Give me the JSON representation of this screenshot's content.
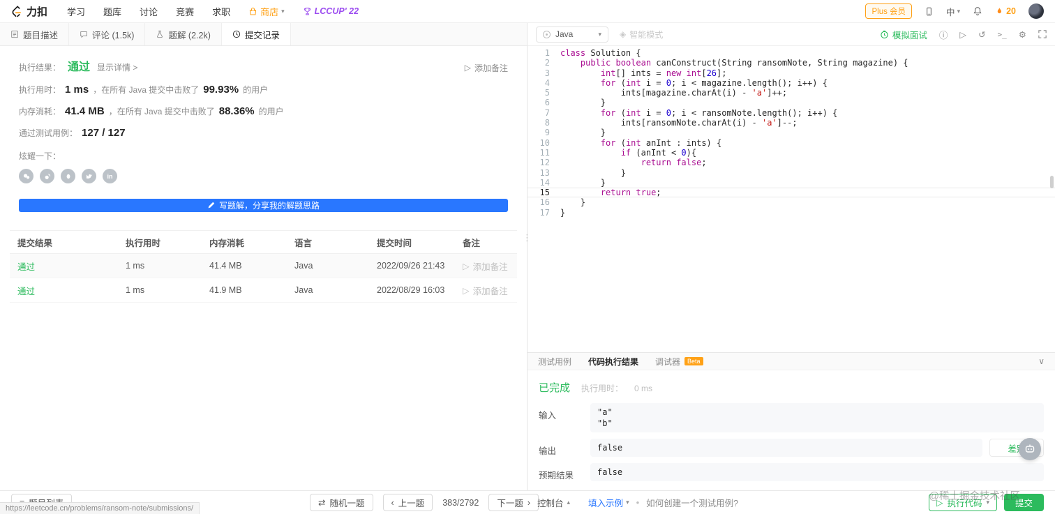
{
  "navbar": {
    "logo_text": "力扣",
    "menu": [
      "学习",
      "题库",
      "讨论",
      "竞赛",
      "求职"
    ],
    "store_label": "商店",
    "lccup_label": "LCCUP' 22",
    "plus_label": "Plus 会员",
    "lang_label": "中",
    "streak_count": "20"
  },
  "left_tabs": {
    "description": "题目描述",
    "comments": "评论 (1.5k)",
    "solutions": "题解 (2.2k)",
    "submissions": "提交记录"
  },
  "result": {
    "exec_label": "执行结果：",
    "status": "通过",
    "detail_link": "显示详情 >",
    "add_note": "添加备注",
    "runtime_label": "执行用时：",
    "runtime_value": "1 ms",
    "runtime_mid": "，在所有 Java 提交中击败了",
    "runtime_pct": "99.93%",
    "runtime_suffix": "的用户",
    "memory_label": "内存消耗：",
    "memory_value": "41.4 MB",
    "memory_mid": "，在所有 Java 提交中击败了",
    "memory_pct": "88.36%",
    "memory_suffix": "的用户",
    "cases_label": "通过测试用例：",
    "cases_value": "127 / 127",
    "brag_label": "炫耀一下：",
    "write_solution": "写题解，分享我的解题思路"
  },
  "table": {
    "headers": [
      "提交结果",
      "执行用时",
      "内存消耗",
      "语言",
      "提交时间",
      "备注"
    ],
    "rows": [
      {
        "status": "通过",
        "runtime": "1 ms",
        "memory": "41.4 MB",
        "lang": "Java",
        "time": "2022/09/26 21:43",
        "note": "添加备注"
      },
      {
        "status": "通过",
        "runtime": "1 ms",
        "memory": "41.9 MB",
        "lang": "Java",
        "time": "2022/08/29 16:03",
        "note": "添加备注"
      }
    ]
  },
  "editor": {
    "language": "Java",
    "smart_mode": "智能模式",
    "mock_interview": "模拟面试",
    "lines": [
      {
        "n": "1",
        "t": [
          [
            "k",
            "class"
          ],
          [
            "p",
            " Solution {"
          ]
        ]
      },
      {
        "n": "2",
        "t": [
          [
            "p",
            "    "
          ],
          [
            "k",
            "public"
          ],
          [
            "p",
            " "
          ],
          [
            "k",
            "boolean"
          ],
          [
            "p",
            " canConstruct(String ransomNote, String magazine) {"
          ]
        ]
      },
      {
        "n": "3",
        "t": [
          [
            "p",
            "        "
          ],
          [
            "k",
            "int"
          ],
          [
            "p",
            "[] ints = "
          ],
          [
            "k",
            "new"
          ],
          [
            "p",
            " "
          ],
          [
            "k",
            "int"
          ],
          [
            "p",
            "["
          ],
          [
            "n2",
            "26"
          ],
          [
            "p",
            "];"
          ]
        ]
      },
      {
        "n": "4",
        "t": [
          [
            "p",
            "        "
          ],
          [
            "k",
            "for"
          ],
          [
            "p",
            " ("
          ],
          [
            "k",
            "int"
          ],
          [
            "p",
            " i = "
          ],
          [
            "n2",
            "0"
          ],
          [
            "p",
            "; i < magazine.length(); i++) {"
          ]
        ]
      },
      {
        "n": "5",
        "t": [
          [
            "p",
            "            ints[magazine.charAt(i) - "
          ],
          [
            "s",
            "'a'"
          ],
          [
            "p",
            "]++;"
          ]
        ]
      },
      {
        "n": "6",
        "t": [
          [
            "p",
            "        }"
          ]
        ]
      },
      {
        "n": "7",
        "t": [
          [
            "p",
            "        "
          ],
          [
            "k",
            "for"
          ],
          [
            "p",
            " ("
          ],
          [
            "k",
            "int"
          ],
          [
            "p",
            " i = "
          ],
          [
            "n2",
            "0"
          ],
          [
            "p",
            "; i < ransomNote.length(); i++) {"
          ]
        ]
      },
      {
        "n": "8",
        "t": [
          [
            "p",
            "            ints[ransomNote.charAt(i) - "
          ],
          [
            "s",
            "'a'"
          ],
          [
            "p",
            "]--;"
          ]
        ]
      },
      {
        "n": "9",
        "t": [
          [
            "p",
            "        }"
          ]
        ]
      },
      {
        "n": "10",
        "t": [
          [
            "p",
            "        "
          ],
          [
            "k",
            "for"
          ],
          [
            "p",
            " ("
          ],
          [
            "k",
            "int"
          ],
          [
            "p",
            " anInt : ints) {"
          ]
        ]
      },
      {
        "n": "11",
        "t": [
          [
            "p",
            "            "
          ],
          [
            "k",
            "if"
          ],
          [
            "p",
            " (anInt < "
          ],
          [
            "n2",
            "0"
          ],
          [
            "p",
            "){"
          ]
        ]
      },
      {
        "n": "12",
        "t": [
          [
            "p",
            "                "
          ],
          [
            "k",
            "return"
          ],
          [
            "p",
            " "
          ],
          [
            "k",
            "false"
          ],
          [
            "p",
            ";"
          ]
        ]
      },
      {
        "n": "13",
        "t": [
          [
            "p",
            "            }"
          ]
        ]
      },
      {
        "n": "14",
        "t": [
          [
            "p",
            "        }"
          ]
        ]
      },
      {
        "n": "15",
        "t": [
          [
            "p",
            "        "
          ],
          [
            "k",
            "return"
          ],
          [
            "p",
            " "
          ],
          [
            "k",
            "true"
          ],
          [
            "p",
            ";"
          ]
        ],
        "current": true
      },
      {
        "n": "16",
        "t": [
          [
            "p",
            "    }"
          ]
        ]
      },
      {
        "n": "17",
        "t": [
          [
            "p",
            "}"
          ]
        ]
      }
    ]
  },
  "console": {
    "tab_testcase": "测试用例",
    "tab_result": "代码执行结果",
    "tab_debugger": "调试器",
    "beta": "Beta",
    "status": "已完成",
    "runtime_label": "执行用时：",
    "runtime_value": "0 ms",
    "input_label": "输入",
    "input_lines": [
      "\"a\"",
      "\"b\""
    ],
    "output_label": "输出",
    "output_value": "false",
    "diff_label": "差别",
    "expected_label": "预期结果",
    "expected_value": "false"
  },
  "footer": {
    "problem_list": "题目列表",
    "random": "随机一题",
    "prev": "上一题",
    "counter": "383/2792",
    "next": "下一题",
    "console_toggle": "控制台",
    "fill_example": "填入示例",
    "divider_dot": "•",
    "help": "如何创建一个测试用例?",
    "run": "执行代码",
    "submit": "提交"
  },
  "status_url": "https://leetcode.cn/problems/ransom-note/submissions/",
  "watermark": "@稀土掘金技术社区",
  "icons": {
    "caret_down": "▾",
    "caret_up": "▴",
    "chevron_left": "‹",
    "chevron_right": "›",
    "play": "▷",
    "shuffle": "⇄",
    "list": "≡",
    "info": "ⓘ",
    "reset": "↺",
    "shortcut": ">_",
    "gear": "⚙",
    "smart": "◈",
    "drag_dots": "⋮",
    "collapse": "∨",
    "linkedin": "in"
  },
  "colors": {
    "green": "#2cbb5d",
    "orange": "#ffa116",
    "blue": "#2977ff"
  }
}
